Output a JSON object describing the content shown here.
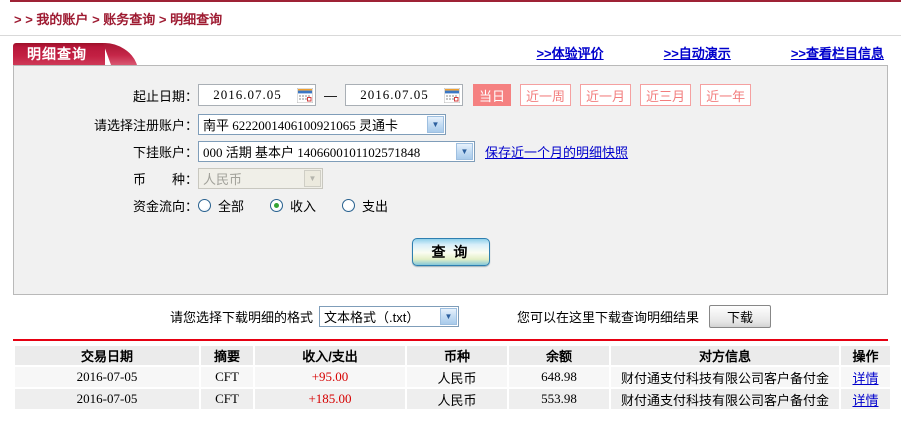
{
  "breadcrumb": {
    "prefix": "> >",
    "separator": ">",
    "items": [
      "我的账户",
      "账务查询",
      "明细查询"
    ]
  },
  "tab": {
    "label": "明细查询"
  },
  "header_links": [
    ">>体验评价",
    ">>自动演示",
    ">>查看栏目信息"
  ],
  "form": {
    "date_label": "起止日期：",
    "date_from": "2016.07.05",
    "date_to": "2016.07.05",
    "date_separator": "—",
    "quick_buttons": [
      "当日",
      "近一周",
      "近一月",
      "近三月",
      "近一年"
    ],
    "account_label": "请选择注册账户：",
    "account_value": "南平  6222001406100921065  灵通卡",
    "sub_account_label": "下挂账户：",
    "sub_account_value": "000 活期 基本户 1406600101102571848",
    "snapshot_link": "保存近一个月的明细快照",
    "currency_label": "币　　种：",
    "currency_value": "人民币",
    "flow_label": "资金流向：",
    "flow_options": [
      "全部",
      "收入",
      "支出"
    ],
    "flow_selected": "收入",
    "query_button": "查 询"
  },
  "download": {
    "format_label": "请您选择下载明细的格式",
    "format_value": "文本格式（.txt）",
    "hint": "您可以在这里下载查询明细结果",
    "button": "下载"
  },
  "table": {
    "headers": [
      "交易日期",
      "摘要",
      "收入/支出",
      "币种",
      "余额",
      "对方信息",
      "操作"
    ],
    "rows": [
      {
        "date": "2016-07-05",
        "summary": "CFT",
        "amount": "+95.00",
        "currency": "人民币",
        "balance": "648.98",
        "counterparty": "财付通支付科技有限公司客户备付金",
        "action": "详情"
      },
      {
        "date": "2016-07-05",
        "summary": "CFT",
        "amount": "+185.00",
        "currency": "人民币",
        "balance": "553.98",
        "counterparty": "财付通支付科技有限公司客户备付金",
        "action": "详情"
      }
    ]
  },
  "icons": {
    "arrow_down": "▼"
  },
  "colors": {
    "brand_red": "#c32043",
    "breadcrumb_red": "#9e1b32",
    "link_blue": "#0000cc",
    "salmon": "#f58181",
    "amount_red": "#d60000",
    "divider_red": "#e60012"
  }
}
